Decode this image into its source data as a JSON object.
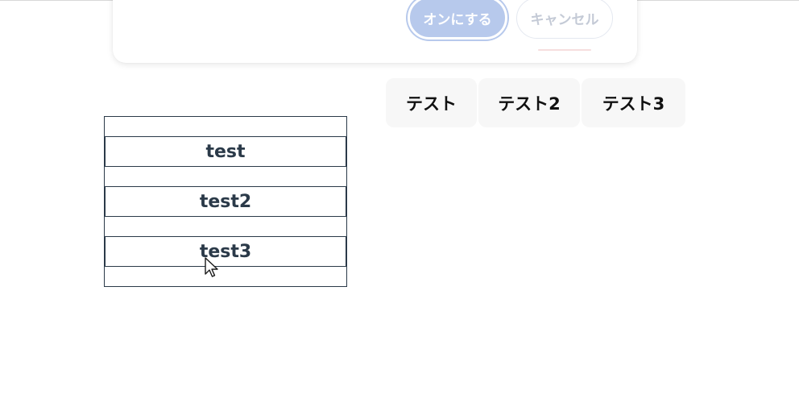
{
  "dialog": {
    "confirm_label": "オンにする",
    "cancel_label": "キャンセル"
  },
  "tabs": [
    {
      "label": "テスト"
    },
    {
      "label": "テスト2"
    },
    {
      "label": "テスト3"
    }
  ],
  "list": {
    "items": [
      {
        "label": "test"
      },
      {
        "label": "test2"
      },
      {
        "label": "test3"
      }
    ]
  },
  "colors": {
    "confirm_bg": "#b7c9ec",
    "list_border": "#2b3a49",
    "tab_bg": "#f7f7f7"
  },
  "icons": {
    "cursor": "mouse-pointer-icon"
  }
}
